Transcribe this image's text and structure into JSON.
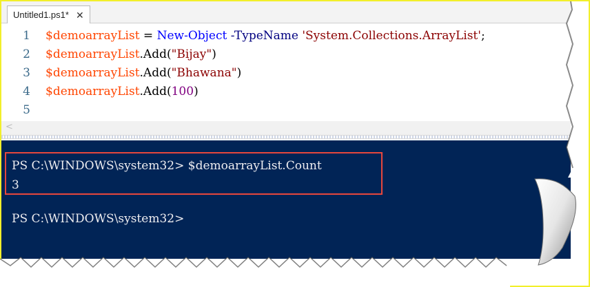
{
  "tab": {
    "title": "Untitled1.ps1*",
    "close_glyph": "✕"
  },
  "editor": {
    "line_numbers": [
      "1",
      "2",
      "3",
      "4",
      "5"
    ],
    "line1": {
      "var": "$demoarrayList",
      "op": " = ",
      "cmd": "New-Object",
      "param": " -TypeName ",
      "str": "'System.Collections.ArrayList'",
      "end": ";"
    },
    "line2": {
      "var": "$demoarrayList",
      "method": ".Add(",
      "str": "\"Bijay\"",
      "end": ")"
    },
    "line3": {
      "var": "$demoarrayList",
      "method": ".Add(",
      "str": "\"Bhawana\"",
      "end": ")"
    },
    "line4": {
      "var": "$demoarrayList",
      "method": ".Add(",
      "num": "100",
      "end": ")"
    }
  },
  "scroll": {
    "left_arrow": "<"
  },
  "console": {
    "line1": "PS C:\\WINDOWS\\system32> $demoarrayList.Count",
    "line2": "3",
    "line3": "PS C:\\WINDOWS\\system32>"
  },
  "colors": {
    "console_bg": "#012456",
    "highlight_border": "#e8473c",
    "frame_border": "#f2ef2a"
  }
}
